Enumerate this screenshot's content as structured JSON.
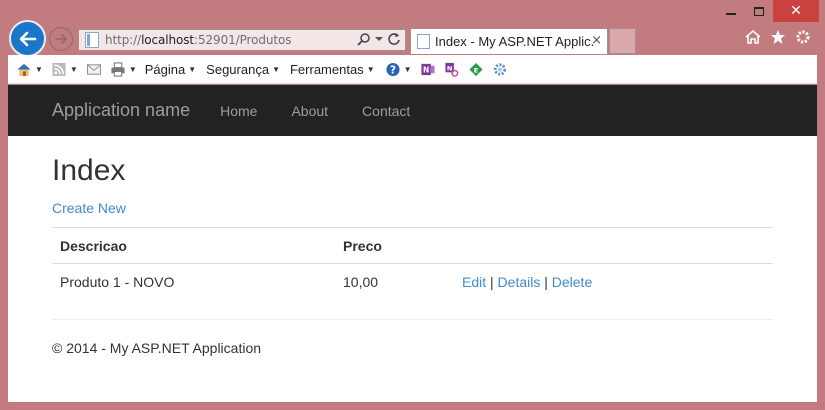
{
  "browser": {
    "url_prefix": "http://",
    "url_host": "localhost",
    "url_rest": ":52901/Produtos",
    "tab_title": "Index - My ASP.NET Applic...",
    "tab_close": "×",
    "window_close": "✕",
    "icons": [
      "back-arrow-icon",
      "forward-arrow-icon",
      "home-icon",
      "favorites-star-icon",
      "settings-gear-icon"
    ]
  },
  "commandbar": {
    "menus": [
      "Página",
      "Segurança",
      "Ferramentas"
    ]
  },
  "navbar": {
    "brand": "Application name",
    "links": [
      "Home",
      "About",
      "Contact"
    ]
  },
  "page": {
    "title": "Index",
    "create_link": "Create New",
    "table": {
      "headers": [
        "Descricao",
        "Preco",
        ""
      ],
      "rows": [
        {
          "descricao": "Produto 1 - NOVO",
          "preco": "10,00",
          "edit": "Edit",
          "details": "Details",
          "delete": "Delete"
        }
      ]
    },
    "footer": "© 2014 - My ASP.NET Application"
  },
  "colors": {
    "frame": "#c27b7f",
    "navbar_bg": "#222222",
    "link": "#428bca"
  }
}
